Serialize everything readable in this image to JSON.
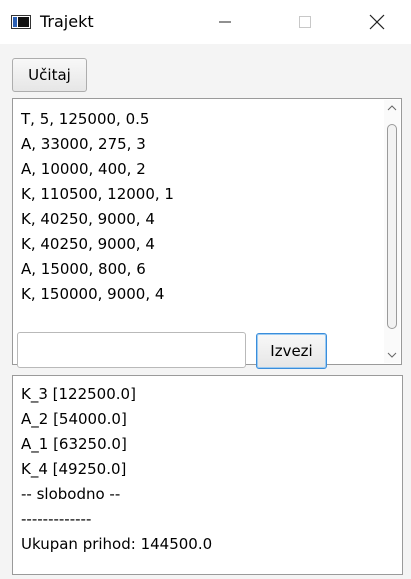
{
  "window": {
    "title": "Trajekt"
  },
  "toolbar": {
    "load_label": "Učitaj"
  },
  "input_list": {
    "items": [
      "T, 5, 125000, 0.5",
      "A, 33000, 275, 3",
      "A, 10000, 400, 2",
      "K, 110500, 12000, 1",
      "K, 40250, 9000, 4",
      "K, 40250, 9000, 4",
      "A, 15000, 800, 6",
      "K, 150000, 9000, 4"
    ]
  },
  "report": {
    "input_value": "",
    "export_label": "Izvezi"
  },
  "output": {
    "lines": [
      "K_3 [122500.0]",
      "A_2 [54000.0]",
      "A_1 [63250.0]",
      "K_4 [49250.0]",
      "-- slobodno --",
      "-------------",
      "Ukupan prihod: 144500.0"
    ]
  }
}
